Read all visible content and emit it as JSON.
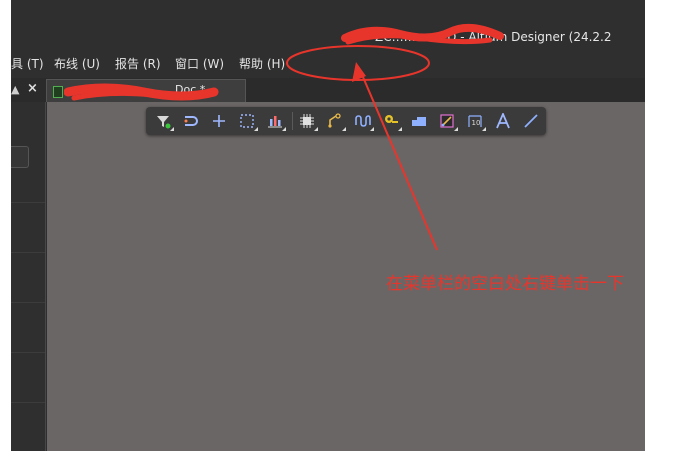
{
  "app": {
    "title": "ZC…………ED - Altium Designer (24.2.2"
  },
  "menubar": {
    "items": [
      {
        "id": "tools",
        "label": "具 (T)"
      },
      {
        "id": "route",
        "label": "布线 (U)"
      },
      {
        "id": "reports",
        "label": "报告 (R)"
      },
      {
        "id": "window",
        "label": "窗口 (W)"
      },
      {
        "id": "help",
        "label": "帮助 (H)"
      }
    ]
  },
  "tabs": {
    "pin_glyph": "▲",
    "close_glyph": "×",
    "document": {
      "label": "…………………………Doc *"
    }
  },
  "toolbar": {
    "tools": [
      {
        "name": "filter-icon"
      },
      {
        "name": "interactive-route-icon"
      },
      {
        "name": "cross-place-icon"
      },
      {
        "name": "select-region-icon"
      },
      {
        "name": "bar-align-icon"
      },
      {
        "name": "component-icon"
      },
      {
        "name": "via-route-icon"
      },
      {
        "name": "length-tune-icon"
      },
      {
        "name": "pad-place-icon"
      },
      {
        "name": "polygon-fill-icon"
      },
      {
        "name": "region-icon"
      },
      {
        "name": "dimension-icon"
      },
      {
        "name": "text-string-icon"
      },
      {
        "name": "line-icon"
      }
    ]
  },
  "annotation": {
    "text": "在菜单栏的空白处右键单击一下",
    "color": "#e8352c"
  }
}
